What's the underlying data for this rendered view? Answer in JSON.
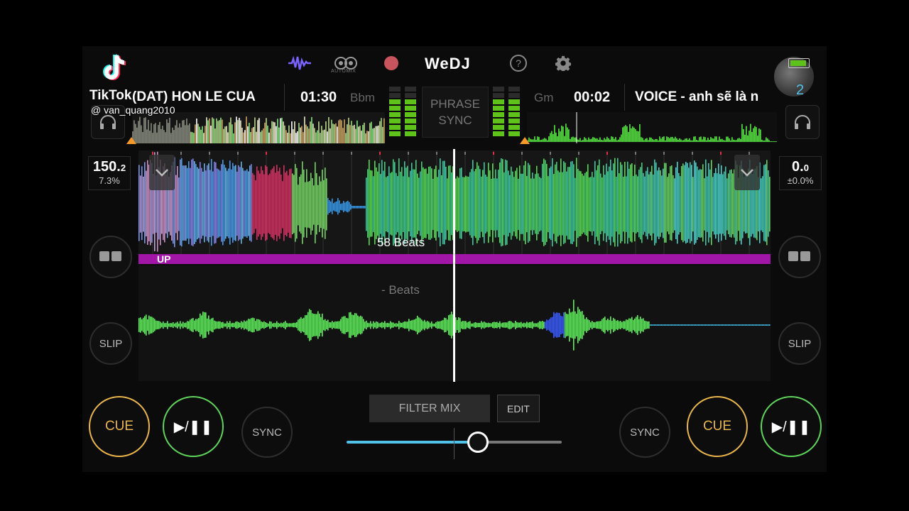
{
  "header": {
    "brand": "WeDJ",
    "automix_label": "AUTOMIX",
    "help_label": "?"
  },
  "overlay": {
    "app_name": "TikTok",
    "username": "@ van_quang2010"
  },
  "deck_a": {
    "title": "(DAT) HON LE CUA",
    "time": "01:30",
    "key": "Bbm",
    "bpm_int": "150.",
    "bpm_dec": "2",
    "pitch": "7.3%",
    "beats_label": "58 Beats",
    "marker_label": "UP",
    "slip_label": "SLIP",
    "cue_label": "CUE",
    "sync_label": "SYNC",
    "play_label": "▶/❚❚"
  },
  "deck_b": {
    "title": "VOICE -  anh sẽ là n",
    "time": "00:02",
    "key": "Gm",
    "bpm_int": "0.",
    "bpm_dec": "0",
    "pitch": "±0.0%",
    "beats_label": "- Beats",
    "slip_label": "SLIP",
    "cue_label": "CUE",
    "sync_label": "SYNC",
    "play_label": "▶/❚❚",
    "knob_number": "2"
  },
  "mixer": {
    "phrase_sync_line1": "PHRASE",
    "phrase_sync_line2": "SYNC",
    "filter_mix_label": "FILTER MIX",
    "edit_label": "EDIT",
    "crossfader_position": 0.61
  },
  "colors": {
    "accent_green": "#5ed45a",
    "cue_orange": "#e9b54a",
    "marker_magenta": "#a116a6",
    "crossfader_blue": "#52c1ea"
  }
}
